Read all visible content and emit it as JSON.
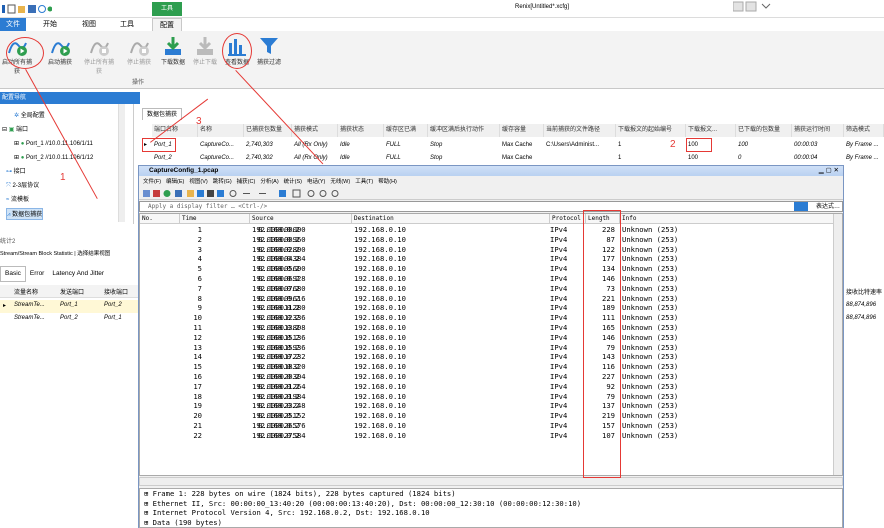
{
  "window": {
    "title": "Renix[Untitled*.xcfg]",
    "context_tab": "工具"
  },
  "ribbon": {
    "tabs": [
      "文件",
      "开始",
      "视图",
      "工具",
      "配置"
    ],
    "buttons": [
      "启动所有捕获",
      "启动捕获",
      "停止所有捕获",
      "停止捕获",
      "下载数据",
      "停止下载",
      "查看数据",
      "捕获过滤"
    ],
    "group_label": "操作"
  },
  "nav": {
    "header": "配置导航",
    "items": [
      "全局配置",
      "端口",
      "Port_1 //10.0.11.106/1/11",
      "Port_2 //10.0.11.106/1/12",
      "接口",
      "2-3层协议",
      "流模板",
      "数据包捕获"
    ]
  },
  "capture_grid": {
    "tab": "数据包捕获",
    "headers": [
      "端口名称",
      "名称",
      "已捕获包数量",
      "捕获模式",
      "捕获状态",
      "缓存区已满",
      "缓冲区满后执行动作",
      "缓存容量",
      "当前捕获的文件路径",
      "下载报文的起始编号",
      "下载报文...",
      "已下载的包数量",
      "捕获运行时间",
      "筛选模式"
    ],
    "rows": [
      [
        "Port_1",
        "CaptureCo...",
        "2,740,303",
        "All (Rx Only)",
        "Idle",
        "FULL",
        "Stop",
        "Max Cache",
        "C:\\Users\\Administ...",
        "1",
        "100",
        "100",
        "00:00:03",
        "By Frame ..."
      ],
      [
        "Port_2",
        "CaptureCo...",
        "2,740,302",
        "All (Rx Only)",
        "Idle",
        "FULL",
        "Stop",
        "Max Cache",
        "",
        "1",
        "100",
        "0",
        "00:00:04",
        "By Frame ..."
      ]
    ]
  },
  "stats": {
    "title": "统计2",
    "tabs_top": [
      "Stream/Stream Block Statistic",
      "选择结果视图"
    ],
    "tabs": [
      "Basic",
      "Error",
      "Latency And Jitter"
    ],
    "headers": [
      "流量名称",
      "发送端口",
      "接收端口"
    ],
    "rows": [
      [
        "StreamTe...",
        "Port_1",
        "Port_2"
      ],
      [
        "StreamTe...",
        "Port_2",
        "Port_1"
      ]
    ],
    "right_header": "接收比特速率",
    "right_values": [
      "88,874,896",
      "88,874,896"
    ]
  },
  "wireshark": {
    "title": "CaptureConfig_1.pcap",
    "menu": [
      "文件(F)",
      "编辑(E)",
      "视图(V)",
      "跳转(G)",
      "捕获(C)",
      "分析(A)",
      "统计(S)",
      "电话(Y)",
      "无线(W)",
      "工具(T)",
      "帮助(H)"
    ],
    "filter_placeholder": "Apply a display filter … <Ctrl-/>",
    "expr_label": "表达式…",
    "columns": [
      "No.",
      "Time",
      "Source",
      "Destination",
      "Protocol",
      "Length",
      "Info"
    ],
    "packets": [
      [
        "1",
        "0.000000000",
        "192.168.0.2",
        "192.168.0.10",
        "IPv4",
        "228",
        "Unknown (253)"
      ],
      [
        "2",
        "0.000000960",
        "192.168.0.2",
        "192.168.0.10",
        "IPv4",
        "87",
        "Unknown (253)"
      ],
      [
        "3",
        "0.000002800",
        "192.168.0.2",
        "192.168.0.10",
        "IPv4",
        "122",
        "Unknown (253)"
      ],
      [
        "4",
        "0.000004384",
        "192.168.0.2",
        "192.168.0.10",
        "IPv4",
        "177",
        "Unknown (253)"
      ],
      [
        "5",
        "0.000005600",
        "192.168.0.2",
        "192.168.0.10",
        "IPv4",
        "134",
        "Unknown (253)"
      ],
      [
        "6",
        "0.000006928",
        "192.168.0.2",
        "192.168.0.10",
        "IPv4",
        "146",
        "Unknown (253)"
      ],
      [
        "7",
        "0.000007680",
        "192.168.0.2",
        "192.168.0.10",
        "IPv4",
        "73",
        "Unknown (253)"
      ],
      [
        "8",
        "0.000009616",
        "192.168.0.2",
        "192.168.0.10",
        "IPv4",
        "221",
        "Unknown (253)"
      ],
      [
        "9",
        "0.000011280",
        "192.168.0.2",
        "192.168.0.10",
        "IPv4",
        "189",
        "Unknown (253)"
      ],
      [
        "10",
        "0.000012336",
        "192.168.0.2",
        "192.168.0.10",
        "IPv4",
        "111",
        "Unknown (253)"
      ],
      [
        "11",
        "0.000013808",
        "192.168.0.2",
        "192.168.0.10",
        "IPv4",
        "165",
        "Unknown (253)"
      ],
      [
        "12",
        "0.000015136",
        "192.168.0.2",
        "192.168.0.10",
        "IPv4",
        "146",
        "Unknown (253)"
      ],
      [
        "13",
        "0.000015936",
        "192.168.0.2",
        "192.168.0.10",
        "IPv4",
        "79",
        "Unknown (253)"
      ],
      [
        "14",
        "0.000017232",
        "192.168.0.2",
        "192.168.0.10",
        "IPv4",
        "143",
        "Unknown (253)"
      ],
      [
        "15",
        "0.000018320",
        "192.168.0.2",
        "192.168.0.10",
        "IPv4",
        "116",
        "Unknown (253)"
      ],
      [
        "16",
        "0.000020304",
        "192.168.0.2",
        "192.168.0.10",
        "IPv4",
        "227",
        "Unknown (253)"
      ],
      [
        "17",
        "0.000021264",
        "192.168.0.2",
        "192.168.0.10",
        "IPv4",
        "92",
        "Unknown (253)"
      ],
      [
        "18",
        "0.000021984",
        "192.168.0.2",
        "192.168.0.10",
        "IPv4",
        "79",
        "Unknown (253)"
      ],
      [
        "19",
        "0.000023248",
        "192.168.0.2",
        "192.168.0.10",
        "IPv4",
        "137",
        "Unknown (253)"
      ],
      [
        "20",
        "0.000025152",
        "192.168.0.2",
        "192.168.0.10",
        "IPv4",
        "219",
        "Unknown (253)"
      ],
      [
        "21",
        "0.000026576",
        "192.168.0.2",
        "192.168.0.10",
        "IPv4",
        "157",
        "Unknown (253)"
      ],
      [
        "22",
        "0.000027584",
        "192.168.0.2",
        "192.168.0.10",
        "IPv4",
        "107",
        "Unknown (253)"
      ]
    ],
    "details": [
      "Frame 1: 228 bytes on wire (1824 bits), 228 bytes captured (1824 bits)",
      "Ethernet II, Src: 00:00:00_13:40:20 (00:00:00:13:40:20), Dst: 00:00:00_12:30:10 (00:00:00:12:30:10)",
      "Internet Protocol Version 4, Src: 192.168.0.2, Dst: 192.168.0.10",
      "Data (190 bytes)"
    ]
  },
  "annotations": {
    "labels": [
      "1",
      "2",
      "3"
    ],
    "color": "#e53935"
  },
  "colors": {
    "accent": "#2b7cd3",
    "annotation": "#e53935",
    "config_tab": "#2e9e4f"
  }
}
